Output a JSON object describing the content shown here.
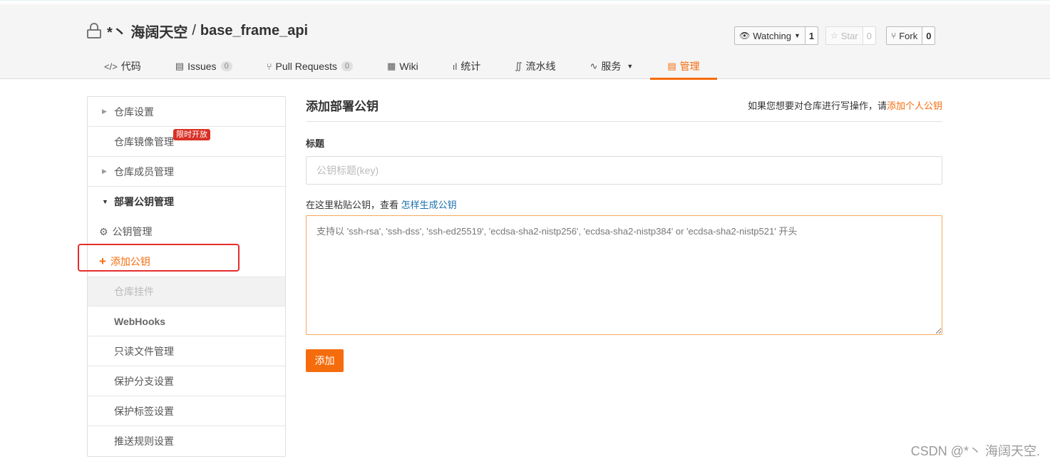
{
  "repo": {
    "owner": "*丶 海阔天空",
    "separator": "/",
    "name": "base_frame_api"
  },
  "social": {
    "watching": {
      "label": "Watching",
      "count": "1"
    },
    "star": {
      "label": "Star",
      "count": "0"
    },
    "fork": {
      "label": "Fork",
      "count": "0"
    }
  },
  "tabs": [
    {
      "icon": "</>",
      "label": "代码"
    },
    {
      "icon": "▤",
      "label": "Issues",
      "badge": "0"
    },
    {
      "icon": "⑂",
      "label": "Pull Requests",
      "badge": "0"
    },
    {
      "icon": "▦",
      "label": "Wiki"
    },
    {
      "icon": "ıl",
      "label": "统计"
    },
    {
      "icon": "∬",
      "label": "流水线"
    },
    {
      "icon": "∿",
      "label": "服务"
    },
    {
      "icon": "▤",
      "label": "管理"
    }
  ],
  "sidebar": {
    "items": [
      {
        "label": "仓库设置"
      },
      {
        "label": "仓库镜像管理",
        "tag": "限时开放"
      },
      {
        "label": "仓库成员管理"
      },
      {
        "label": "部署公钥管理"
      },
      {
        "label": "公钥管理"
      },
      {
        "label": "添加公钥"
      },
      {
        "label": "仓库挂件"
      },
      {
        "label": "WebHooks"
      },
      {
        "label": "只读文件管理"
      },
      {
        "label": "保护分支设置"
      },
      {
        "label": "保护标签设置"
      },
      {
        "label": "推送规则设置"
      }
    ]
  },
  "main": {
    "title": "添加部署公钥",
    "hint_text": "如果您想要对仓库进行写操作，请",
    "hint_link": "添加个人公钥",
    "title_label": "标题",
    "title_placeholder": "公钥标题(key)",
    "paste_label": "在这里粘贴公钥，查看",
    "paste_link": "怎样生成公钥",
    "key_placeholder": "支持以 'ssh-rsa', 'ssh-dss', 'ssh-ed25519', 'ecdsa-sha2-nistp256', 'ecdsa-sha2-nistp384' or 'ecdsa-sha2-nistp521' 开头",
    "submit_label": "添加"
  },
  "watermark": "CSDN @*丶 海阔天空.",
  "colors": {
    "accent": "#f56c0c",
    "link": "#1a6fae",
    "highlight": "#e52d2d",
    "tag": "#d93025"
  }
}
